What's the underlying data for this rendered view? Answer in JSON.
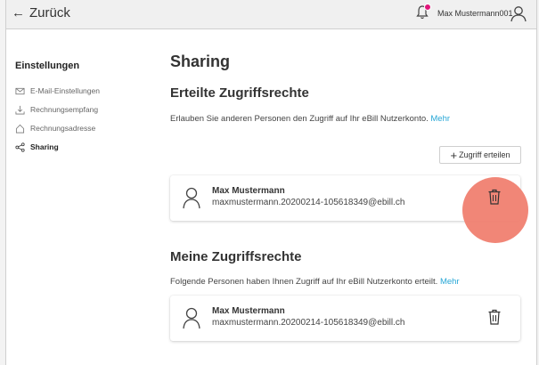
{
  "header": {
    "back_label": "Zurück",
    "username": "Max Mustermann001",
    "bell_badge_color": "#e0157a"
  },
  "sidebar": {
    "title": "Einstellungen",
    "items": [
      {
        "label": "E-Mail-Einstellungen",
        "icon": "mail-icon",
        "active": false
      },
      {
        "label": "Rechnungsempfang",
        "icon": "download-icon",
        "active": false
      },
      {
        "label": "Rechnungsadresse",
        "icon": "home-icon",
        "active": false
      },
      {
        "label": "Sharing",
        "icon": "share-icon",
        "active": true
      }
    ]
  },
  "main": {
    "title": "Sharing",
    "granted": {
      "heading": "Erteilte Zugriffsrechte",
      "description": "Erlauben Sie anderen Personen den Zugriff auf Ihr eBill Nutzerkonto.",
      "more_label": "Mehr",
      "grant_button_label": "Zugriff erteilen",
      "entries": [
        {
          "name": "Max Mustermann",
          "email": "maxmustermann.20200214-105618349@ebill.ch"
        }
      ]
    },
    "mine": {
      "heading": "Meine Zugriffsrechte",
      "description": "Folgende Personen haben Ihnen Zugriff auf Ihr eBill Nutzerkonto erteilt.",
      "more_label": "Mehr",
      "entries": [
        {
          "name": "Max Mustermann",
          "email": "maxmustermann.20200214-105618349@ebill.ch"
        }
      ]
    }
  },
  "colors": {
    "accent_link": "#27a7d6",
    "highlight_circle": "#f08070"
  }
}
